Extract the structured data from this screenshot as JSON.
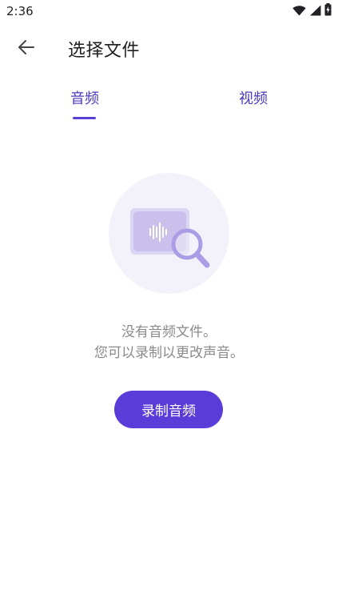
{
  "status_bar": {
    "time": "2:36",
    "icons": [
      "wifi-icon",
      "signal-icon",
      "battery-charging-icon"
    ]
  },
  "app_bar": {
    "back_icon": "arrow-back-icon",
    "title": "选择文件"
  },
  "tabs": [
    {
      "label": "音频",
      "selected": true
    },
    {
      "label": "视频",
      "selected": false
    }
  ],
  "empty_state": {
    "illustration_icon": "audio-file-search-icon",
    "line1": "没有音频文件。",
    "line2": "您可以录制以更改声音。"
  },
  "record_button": {
    "label": "录制音频"
  },
  "colors": {
    "accent": "#5a3cd9",
    "tab_text": "#4a3ac0",
    "empty_text": "#8a8a8a",
    "illustration_bg": "#f3f1fa",
    "illustration_card": "#c9c1ec",
    "illustration_lens": "#ab9ce6"
  }
}
